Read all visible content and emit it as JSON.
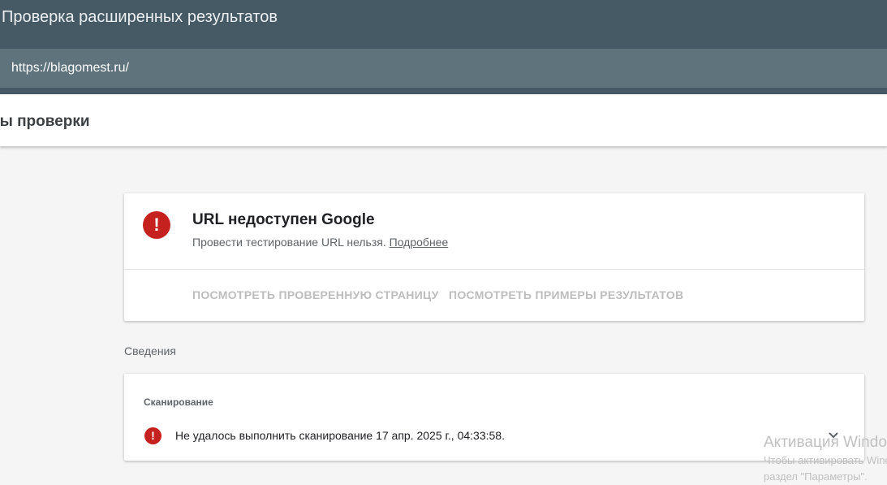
{
  "app": {
    "title": "Проверка расширенных результатов",
    "url": "https://blagomest.ru/"
  },
  "results": {
    "title": "ультаты проверки"
  },
  "status": {
    "icon": "error-icon",
    "title": "URL недоступен Google",
    "description": "Провести тестирование URL нельзя.",
    "more_link": "Подробнее",
    "actions": {
      "view_page": "ПОСМОТРЕТЬ ПРОВЕРЕННУЮ СТРАНИЦУ",
      "view_examples": "ПОСМОТРЕТЬ ПРИМЕРЫ РЕЗУЛЬТАТОВ"
    }
  },
  "details": {
    "section_label": "Сведения",
    "scan_label": "Сканирование",
    "scan_message": "Не удалось выполнить сканирование 17 апр. 2025 г., 04:33:58."
  },
  "watermark": {
    "title": "Активация Windows",
    "line1": "Чтобы активировать Windows, перейдите в",
    "line2": "раздел \"Параметры\"."
  },
  "colors": {
    "app_bar": "#455a64",
    "url_bar": "#5f737d",
    "error": "#c5221f",
    "disabled_action": "#bdbdbd"
  }
}
